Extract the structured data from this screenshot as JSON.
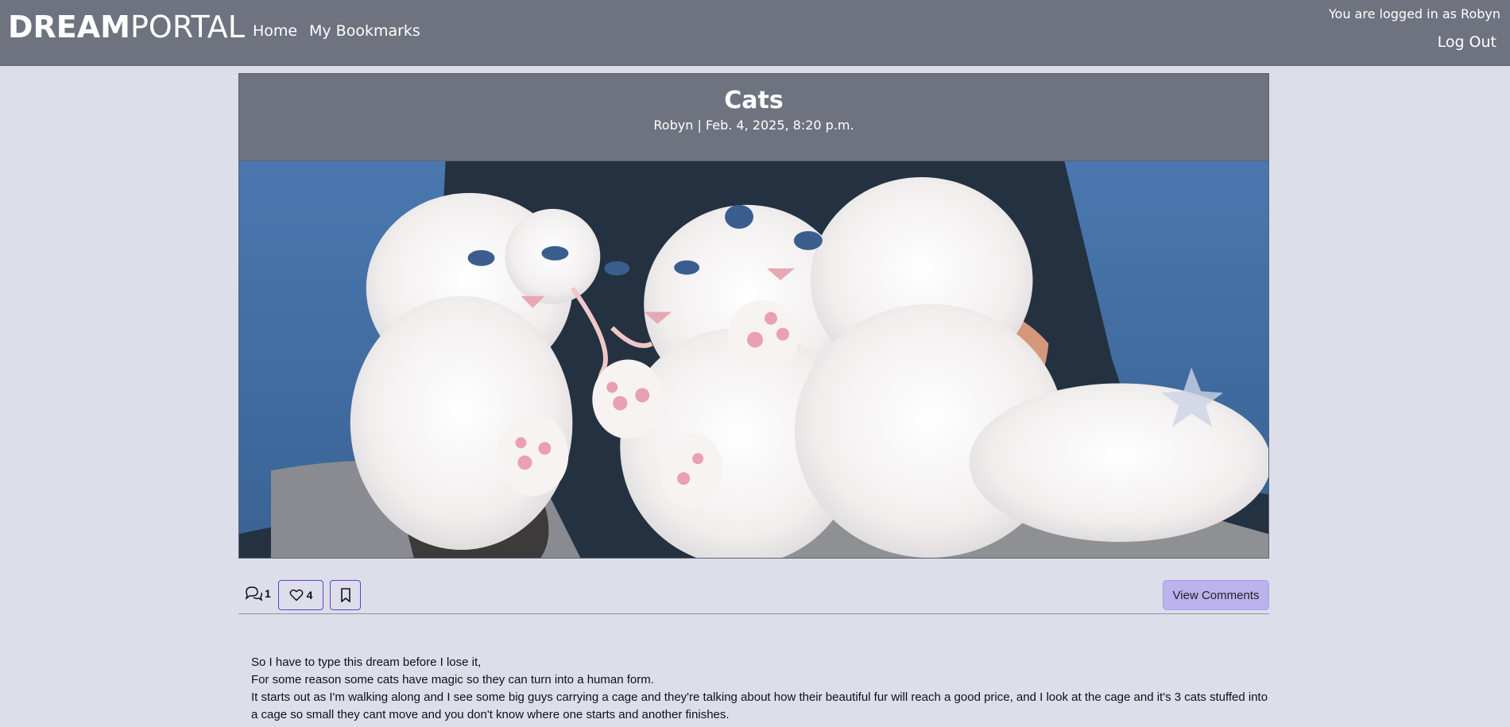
{
  "navbar": {
    "brand_bold": "DREAM",
    "brand_light": "PORTAL",
    "links": [
      "Home",
      "My Bookmarks"
    ],
    "logged_in_text": "You are logged in as Robyn",
    "logout_label": "Log Out"
  },
  "post": {
    "title": "Cats",
    "meta": "Robyn | Feb. 4, 2025, 8:20 p.m.",
    "comment_count": "1",
    "like_count": "4",
    "view_comments_label": "View Comments",
    "body": [
      "So I have to type this dream before I lose it,",
      "For some reason some cats have magic so they can turn into a human form.",
      "It starts out as I'm walking along and I see some big guys carrying a cage and they're talking about how their beautiful fur will reach a good price, and I look at the cage and it's  3 cats stuffed into a cage so small they cant move and you don't know where one starts and another finishes."
    ]
  },
  "icons": {
    "comment": "comment-icon",
    "heart": "heart-icon",
    "bookmark": "bookmark-icon"
  },
  "colors": {
    "navbar_bg": "#6e737f",
    "page_bg": "#dcdfea",
    "accent_border": "#6a3bd0",
    "view_comments_bg": "#bcb2ee"
  }
}
